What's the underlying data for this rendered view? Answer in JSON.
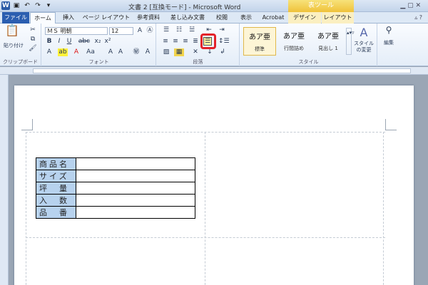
{
  "window": {
    "title": "文書 2 [互換モード] - Microsoft Word",
    "context_tool": "表ツール",
    "app_icon": "W"
  },
  "tabs": [
    "ファイル",
    "ホーム",
    "挿入",
    "ページ レイアウト",
    "参考資料",
    "差し込み文書",
    "校閲",
    "表示",
    "Acrobat",
    "デザイン",
    "レイアウト"
  ],
  "ribbon": {
    "clipboard": {
      "paste_label": "貼り付け",
      "group_label": "クリップボード"
    },
    "font": {
      "font_name": "ＭＳ 明朝",
      "font_size": "12",
      "group_label": "フォント"
    },
    "paragraph": {
      "group_label": "段落"
    },
    "styles": {
      "group_label": "スタイル",
      "items": [
        {
          "sample": "あア亜",
          "name": "標準"
        },
        {
          "sample": "あア亜",
          "name": "行間詰め"
        },
        {
          "sample": "あア亜",
          "name": "見出し 1"
        }
      ],
      "change_label": "スタイルの変更"
    },
    "editing": {
      "label": "編集"
    }
  },
  "document": {
    "table": [
      {
        "label": "商品名",
        "value": ""
      },
      {
        "label": "サイズ",
        "value": ""
      },
      {
        "label": "坪　量",
        "value": ""
      },
      {
        "label": "入　数",
        "value": ""
      },
      {
        "label": "品　番",
        "value": ""
      }
    ]
  },
  "colors": {
    "file_tab": "#2b5eb0",
    "label_cell": "#b7d2ee",
    "highlight": "#e3222a",
    "context_tab": "#f0c43c"
  }
}
